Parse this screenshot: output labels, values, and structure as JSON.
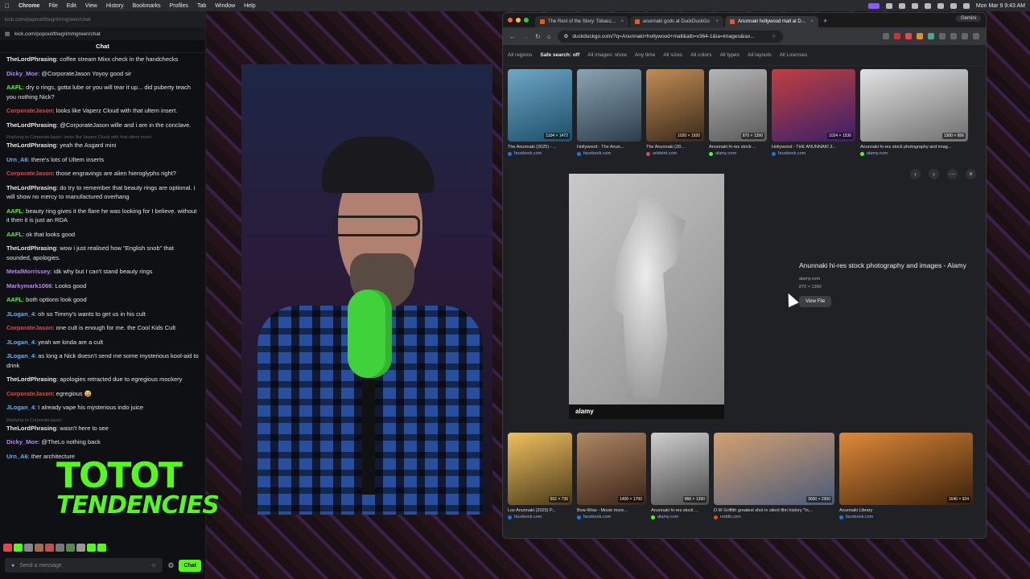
{
  "menubar": {
    "app": "Chrome",
    "items": [
      "File",
      "Edit",
      "View",
      "History",
      "Bookmarks",
      "Profiles",
      "Tab",
      "Window",
      "Help"
    ],
    "clock": "Mon Mar 9  9:43 AM"
  },
  "chat": {
    "url_faded": "kick.com/popout/thegrimmgreen/chat",
    "url": "kick.com/popout/thegrimmgreen/chat",
    "header": "Chat",
    "messages": [
      {
        "user": "TheLordPhrasing",
        "color": "#e9e9e9",
        "text": ": coffee stream Mixx check in the handchecks"
      },
      {
        "user": "Dicky_Moe",
        "color": "#b784f5",
        "text": ": @CorporateJason Yoyoy good sir"
      },
      {
        "user": "AAFL",
        "color": "#53fc18",
        "text": ": dry o rings, gotta lube or you will tear it up... did puberty teach you nothing Nick?"
      },
      {
        "user": "CorporateJason",
        "color": "#e0474b",
        "text": ": looks like Vaperz Cloud with that ultem insert."
      },
      {
        "user": "TheLordPhrasing",
        "color": "#e9e9e9",
        "text": ": @CorporateJason wille and i are in the conclave."
      },
      {
        "reply": "Replying to CorporateJason: looks like Vaperz Cloud with that ultem insert."
      },
      {
        "user": "TheLordPhrasing",
        "color": "#e9e9e9",
        "text": ": yeah the Asgard mini"
      },
      {
        "user": "Urn_A6",
        "color": "#5ab4f8",
        "text": ": there's lots of Ultem inserts"
      },
      {
        "user": "CorporateJason",
        "color": "#e0474b",
        "text": ": those engravings are alien hieroglyphs right?"
      },
      {
        "user": "TheLordPhrasing",
        "color": "#e9e9e9",
        "text": ": do try to remember that beauty rings are optional. i will show no mercy to manufactured overhang"
      },
      {
        "user": "AAFL",
        "color": "#53fc18",
        "text": ": beauty ring gives it the flare he was looking for I believe. without it then it is just an RDA"
      },
      {
        "user": "AAFL",
        "color": "#53fc18",
        "text": ": ok that looks good"
      },
      {
        "user": "TheLordPhrasing",
        "color": "#e9e9e9",
        "text": ": wow i just realised how \"English snob\" that sounded, apologies."
      },
      {
        "user": "MetalMorrissey",
        "color": "#b784f5",
        "text": ": idk why but I can't stand beauty rings"
      },
      {
        "user": "Markymark1066",
        "color": "#b784f5",
        "text": ": Looks good"
      },
      {
        "user": "AAFL",
        "color": "#53fc18",
        "text": ": both options look good"
      },
      {
        "user": "JLogan_4",
        "color": "#5ab4f8",
        "text": ": oh so Timmy's wants to get us in his cult"
      },
      {
        "user": "CorporateJason",
        "color": "#e0474b",
        "text": ": one cult is enough for me. the Cool Kids Cult"
      },
      {
        "user": "JLogan_4",
        "color": "#5ab4f8",
        "text": ": yeah we kinda are a cult"
      },
      {
        "user": "JLogan_4",
        "color": "#5ab4f8",
        "text": ": as long a Nick doesn't send me some mysterious kool-aid to drink"
      },
      {
        "user": "TheLordPhrasing",
        "color": "#e9e9e9",
        "text": ": apologies retracted due to egregious mockery"
      },
      {
        "user": "CorporateJason",
        "color": "#e0474b",
        "text": ": egregious 😀"
      },
      {
        "user": "JLogan_4",
        "color": "#5ab4f8",
        "text": ": I already vape his mysterious indo juice"
      },
      {
        "reply": "Replying to CorporateJason:"
      },
      {
        "user": "TheLordPhrasing",
        "color": "#e9e9e9",
        "text": ": wasn't here to see"
      },
      {
        "user": "Dicky_Moe",
        "color": "#b784f5",
        "text": ": @TheLo nothing back"
      },
      {
        "user": "Urn_A6",
        "color": "#5ab4f8",
        "text": ": ther architecture"
      }
    ],
    "input_placeholder": "Send a message",
    "send_label": "Chat"
  },
  "overlay_logo": {
    "line1": "TOTOT",
    "line2": "TENDENCIES"
  },
  "browser": {
    "tabs": [
      {
        "label": "The Rest of the Story: Tobacc...",
        "active": false,
        "color": "#e8590c"
      },
      {
        "label": "anunnaki gods at DuckDuckGo",
        "active": false,
        "color": "#de5833"
      },
      {
        "label": "Anunnaki hollywood mall at D...",
        "active": true,
        "color": "#de5833"
      }
    ],
    "new_tab": "+",
    "gemini": "Gemini",
    "url": "duckduckgo.com/?q=Anunnaki+hollywood+mall&atb=v364-1&ia=images&iax...",
    "filters": [
      "All regions",
      "Safe search: off",
      "All images: show",
      "Any time",
      "All sizes",
      "All colors",
      "All types",
      "All layouts",
      "All Licenses"
    ],
    "top_images": [
      {
        "caption": "The Anunnaki (2025) - ...",
        "source": "facebook.com",
        "res": "1104 × 1472",
        "w": 80,
        "c1": "#1c4e6b",
        "c2": "#6fa7c4",
        "dot": "#1877f2"
      },
      {
        "caption": "Hollywood - The Anun...",
        "source": "facebook.com",
        "res": "",
        "w": 80,
        "c1": "#2d3d4a",
        "c2": "#8aa4b3",
        "dot": "#1877f2"
      },
      {
        "caption": "The Anunnaki (20...",
        "source": "urlebird.com",
        "res": "1020 × 1920",
        "w": 72,
        "c1": "#3a2a1a",
        "c2": "#c28c55",
        "dot": "#e0474b"
      },
      {
        "caption": "Anunnaki hi-res stock ...",
        "source": "alamy.com",
        "res": "870 × 1390",
        "w": 72,
        "c1": "#5a5a5a",
        "c2": "#b5b5b5",
        "dot": "#53fc18"
      },
      {
        "caption": "Hollywood - THE ANUNNAKI 3...",
        "source": "facebook.com",
        "res": "1024 × 1536",
        "w": 104,
        "c1": "#3a1f6a",
        "c2": "#c04040",
        "dot": "#1877f2"
      },
      {
        "caption": "Anunnaki hi-res stock photography and imag...",
        "source": "alamy.com",
        "res": "1300 × 956",
        "w": 134,
        "c1": "#6f6f6f",
        "c2": "#e2e2e2",
        "dot": "#53fc18"
      }
    ],
    "detail": {
      "title": "Anunnaki hi-res stock photography and images - Alamy",
      "site": "alamy.com",
      "dims": "870 × 1390",
      "view_label": "View File",
      "watermark": "alamy"
    },
    "bottom_images": [
      {
        "caption": "Los Anunnaki (2025) P...",
        "source": "facebook.com",
        "res": "552 × 736",
        "w": 80,
        "c1": "#4a3a1a",
        "c2": "#f0c060",
        "dot": "#1877f2"
      },
      {
        "caption": "Bow-Wow - Movie more...",
        "source": "facebook.com",
        "res": "1400 × 1700",
        "w": 86,
        "c1": "#3a2418",
        "c2": "#b08864",
        "dot": "#1877f2"
      },
      {
        "caption": "Anunnaki hi-res stock ...",
        "source": "alamy.com",
        "res": "866 × 1390",
        "w": 72,
        "c1": "#4a4a4a",
        "c2": "#cfcfcf",
        "dot": "#53fc18"
      },
      {
        "caption": "D.W Griffith greatest shot in silent film history \"In...",
        "source": "reddit.com",
        "res": "3600 × 2300",
        "w": 150,
        "c1": "#4a5a7a",
        "c2": "#d4a070",
        "dot": "#ff4500"
      },
      {
        "caption": "Anunnaki Library",
        "source": "facebook.com",
        "res": "1640 × 924",
        "w": 166,
        "c1": "#3a200a",
        "c2": "#e08a3a",
        "dot": "#1877f2"
      }
    ]
  }
}
